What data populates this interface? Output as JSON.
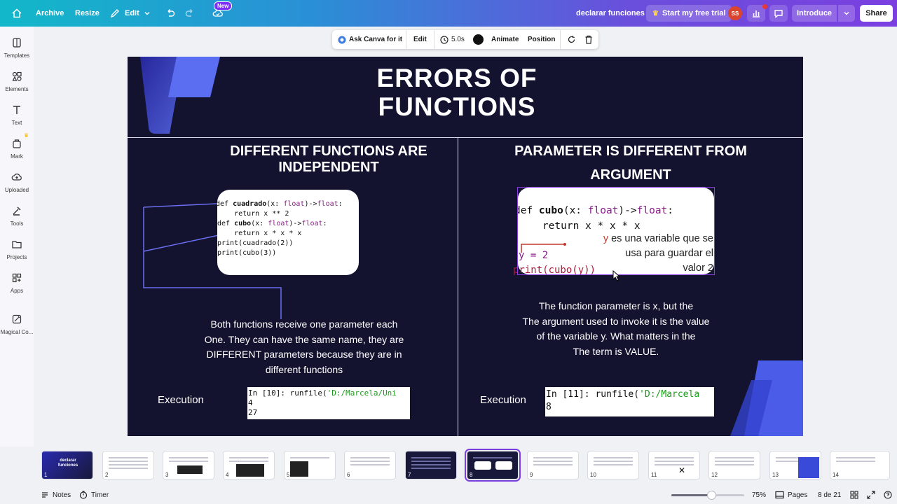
{
  "topbar": {
    "archive": "Archive",
    "resize": "Resize",
    "edit": "Edit",
    "new_badge": "New",
    "doc_title": "declarar funciones",
    "trial": "Start my free trial",
    "avatar_initials": "SS",
    "introduce": "Introduce",
    "share": "Share"
  },
  "sidebar": {
    "items": [
      {
        "label": "Templates",
        "icon": "templates-icon"
      },
      {
        "label": "Elements",
        "icon": "elements-icon"
      },
      {
        "label": "Text",
        "icon": "text-icon"
      },
      {
        "label": "Mark",
        "icon": "mark-icon"
      },
      {
        "label": "Uploaded",
        "icon": "upload-icon"
      },
      {
        "label": "Tools",
        "icon": "tools-icon"
      },
      {
        "label": "Projects",
        "icon": "folder-icon"
      },
      {
        "label": "Apps",
        "icon": "apps-icon"
      },
      {
        "label": "Magical Co...",
        "icon": "magic-icon"
      }
    ]
  },
  "context_toolbar": {
    "ask": "Ask Canva for it",
    "edit": "Edit",
    "duration": "5.0s",
    "animate": "Animate",
    "position": "Position"
  },
  "slide": {
    "title_line1": "ERRORS OF",
    "title_line2": "FUNCTIONS",
    "left": {
      "heading_line1": "DIFFERENT FUNCTIONS ARE",
      "heading_line2": "INDEPENDENT",
      "code": [
        {
          "pre": "def ",
          "name": "cuadrado",
          "sig": "(x: ",
          "type1": "float",
          "mid": ")->",
          "type2": "float",
          "post": ":"
        },
        {
          "line": "    return x ** 2"
        },
        {
          "line": ""
        },
        {
          "pre": "def ",
          "name": "cubo",
          "sig": "(x: ",
          "type1": "float",
          "mid": ")->",
          "type2": "float",
          "post": ":"
        },
        {
          "line": "    return x * x * x"
        },
        {
          "line": ""
        },
        {
          "line": ""
        },
        {
          "line": "print(cuadrado(2))"
        },
        {
          "line": "print(cubo(3))"
        }
      ],
      "body_lines": [
        "Both functions receive one parameter each",
        "One. They can have the same name, they are",
        "DIFFERENT parameters because they are in",
        "different functions"
      ],
      "execution_label": "Execution",
      "console_prompt": "In [10]: runfile(",
      "console_string": "'D:/Marcela/Uni",
      "console_out": [
        "4",
        "27"
      ]
    },
    "right": {
      "heading_line1": "PARAMETER IS DIFFERENT FROM",
      "heading_line2": "ARGUMENT",
      "code_line1": {
        "pre": "def ",
        "name": "cubo",
        "sig": "(x: ",
        "type1": "float",
        "mid": ")->",
        "type2": "float",
        "post": ":"
      },
      "code_line2": "    return x * x * x",
      "code_line3": "y = 2",
      "code_line4": "print(cubo(y))",
      "annotation_var": "y",
      "annotation_lines": [
        "es una variable que se",
        "usa para guardar el",
        "valor 2"
      ],
      "body_lines": [
        "The function parameter is x, but the",
        "The argument used to invoke it is the value",
        "of the variable y. What matters in the",
        "The term is VALUE."
      ],
      "execution_label": "Execution",
      "console_prompt": "In [11]: runfile(",
      "console_string": "'D:/Marcela",
      "console_out": [
        "8"
      ]
    }
  },
  "filmstrip": {
    "pages": [
      "1",
      "2",
      "3",
      "4",
      "5",
      "6",
      "7",
      "8",
      "9",
      "10",
      "11",
      "12",
      "13",
      "14"
    ],
    "selected": "8",
    "thumb1_line1": "declarar",
    "thumb1_line2": "funciones"
  },
  "bottombar": {
    "notes": "Notes",
    "timer": "Timer",
    "zoom": "75%",
    "zoom_fraction": 0.55,
    "pages": "Pages",
    "page_count": "8 de 21"
  },
  "colors": {
    "slide_bg": "#131330",
    "accent_purple": "#7b3fe0",
    "accent_blue": "#4a5ce8",
    "topbar_gradient_start": "#12b8c9",
    "topbar_gradient_end": "#7b3fe0"
  }
}
